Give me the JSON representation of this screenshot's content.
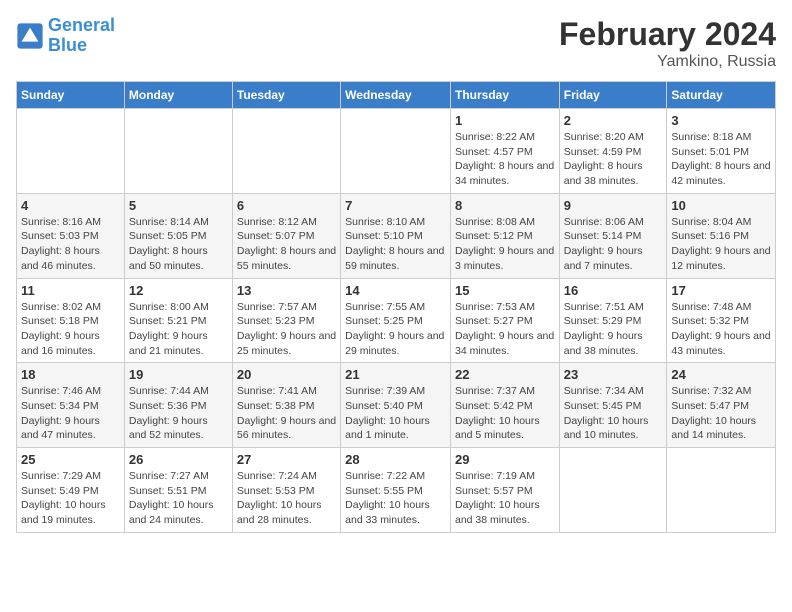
{
  "logo": {
    "line1": "General",
    "line2": "Blue"
  },
  "header": {
    "month": "February 2024",
    "location": "Yamkino, Russia"
  },
  "weekdays": [
    "Sunday",
    "Monday",
    "Tuesday",
    "Wednesday",
    "Thursday",
    "Friday",
    "Saturday"
  ],
  "weeks": [
    [
      {
        "day": "",
        "sunrise": "",
        "sunset": "",
        "daylight": ""
      },
      {
        "day": "",
        "sunrise": "",
        "sunset": "",
        "daylight": ""
      },
      {
        "day": "",
        "sunrise": "",
        "sunset": "",
        "daylight": ""
      },
      {
        "day": "",
        "sunrise": "",
        "sunset": "",
        "daylight": ""
      },
      {
        "day": "1",
        "sunrise": "Sunrise: 8:22 AM",
        "sunset": "Sunset: 4:57 PM",
        "daylight": "Daylight: 8 hours and 34 minutes."
      },
      {
        "day": "2",
        "sunrise": "Sunrise: 8:20 AM",
        "sunset": "Sunset: 4:59 PM",
        "daylight": "Daylight: 8 hours and 38 minutes."
      },
      {
        "day": "3",
        "sunrise": "Sunrise: 8:18 AM",
        "sunset": "Sunset: 5:01 PM",
        "daylight": "Daylight: 8 hours and 42 minutes."
      }
    ],
    [
      {
        "day": "4",
        "sunrise": "Sunrise: 8:16 AM",
        "sunset": "Sunset: 5:03 PM",
        "daylight": "Daylight: 8 hours and 46 minutes."
      },
      {
        "day": "5",
        "sunrise": "Sunrise: 8:14 AM",
        "sunset": "Sunset: 5:05 PM",
        "daylight": "Daylight: 8 hours and 50 minutes."
      },
      {
        "day": "6",
        "sunrise": "Sunrise: 8:12 AM",
        "sunset": "Sunset: 5:07 PM",
        "daylight": "Daylight: 8 hours and 55 minutes."
      },
      {
        "day": "7",
        "sunrise": "Sunrise: 8:10 AM",
        "sunset": "Sunset: 5:10 PM",
        "daylight": "Daylight: 8 hours and 59 minutes."
      },
      {
        "day": "8",
        "sunrise": "Sunrise: 8:08 AM",
        "sunset": "Sunset: 5:12 PM",
        "daylight": "Daylight: 9 hours and 3 minutes."
      },
      {
        "day": "9",
        "sunrise": "Sunrise: 8:06 AM",
        "sunset": "Sunset: 5:14 PM",
        "daylight": "Daylight: 9 hours and 7 minutes."
      },
      {
        "day": "10",
        "sunrise": "Sunrise: 8:04 AM",
        "sunset": "Sunset: 5:16 PM",
        "daylight": "Daylight: 9 hours and 12 minutes."
      }
    ],
    [
      {
        "day": "11",
        "sunrise": "Sunrise: 8:02 AM",
        "sunset": "Sunset: 5:18 PM",
        "daylight": "Daylight: 9 hours and 16 minutes."
      },
      {
        "day": "12",
        "sunrise": "Sunrise: 8:00 AM",
        "sunset": "Sunset: 5:21 PM",
        "daylight": "Daylight: 9 hours and 21 minutes."
      },
      {
        "day": "13",
        "sunrise": "Sunrise: 7:57 AM",
        "sunset": "Sunset: 5:23 PM",
        "daylight": "Daylight: 9 hours and 25 minutes."
      },
      {
        "day": "14",
        "sunrise": "Sunrise: 7:55 AM",
        "sunset": "Sunset: 5:25 PM",
        "daylight": "Daylight: 9 hours and 29 minutes."
      },
      {
        "day": "15",
        "sunrise": "Sunrise: 7:53 AM",
        "sunset": "Sunset: 5:27 PM",
        "daylight": "Daylight: 9 hours and 34 minutes."
      },
      {
        "day": "16",
        "sunrise": "Sunrise: 7:51 AM",
        "sunset": "Sunset: 5:29 PM",
        "daylight": "Daylight: 9 hours and 38 minutes."
      },
      {
        "day": "17",
        "sunrise": "Sunrise: 7:48 AM",
        "sunset": "Sunset: 5:32 PM",
        "daylight": "Daylight: 9 hours and 43 minutes."
      }
    ],
    [
      {
        "day": "18",
        "sunrise": "Sunrise: 7:46 AM",
        "sunset": "Sunset: 5:34 PM",
        "daylight": "Daylight: 9 hours and 47 minutes."
      },
      {
        "day": "19",
        "sunrise": "Sunrise: 7:44 AM",
        "sunset": "Sunset: 5:36 PM",
        "daylight": "Daylight: 9 hours and 52 minutes."
      },
      {
        "day": "20",
        "sunrise": "Sunrise: 7:41 AM",
        "sunset": "Sunset: 5:38 PM",
        "daylight": "Daylight: 9 hours and 56 minutes."
      },
      {
        "day": "21",
        "sunrise": "Sunrise: 7:39 AM",
        "sunset": "Sunset: 5:40 PM",
        "daylight": "Daylight: 10 hours and 1 minute."
      },
      {
        "day": "22",
        "sunrise": "Sunrise: 7:37 AM",
        "sunset": "Sunset: 5:42 PM",
        "daylight": "Daylight: 10 hours and 5 minutes."
      },
      {
        "day": "23",
        "sunrise": "Sunrise: 7:34 AM",
        "sunset": "Sunset: 5:45 PM",
        "daylight": "Daylight: 10 hours and 10 minutes."
      },
      {
        "day": "24",
        "sunrise": "Sunrise: 7:32 AM",
        "sunset": "Sunset: 5:47 PM",
        "daylight": "Daylight: 10 hours and 14 minutes."
      }
    ],
    [
      {
        "day": "25",
        "sunrise": "Sunrise: 7:29 AM",
        "sunset": "Sunset: 5:49 PM",
        "daylight": "Daylight: 10 hours and 19 minutes."
      },
      {
        "day": "26",
        "sunrise": "Sunrise: 7:27 AM",
        "sunset": "Sunset: 5:51 PM",
        "daylight": "Daylight: 10 hours and 24 minutes."
      },
      {
        "day": "27",
        "sunrise": "Sunrise: 7:24 AM",
        "sunset": "Sunset: 5:53 PM",
        "daylight": "Daylight: 10 hours and 28 minutes."
      },
      {
        "day": "28",
        "sunrise": "Sunrise: 7:22 AM",
        "sunset": "Sunset: 5:55 PM",
        "daylight": "Daylight: 10 hours and 33 minutes."
      },
      {
        "day": "29",
        "sunrise": "Sunrise: 7:19 AM",
        "sunset": "Sunset: 5:57 PM",
        "daylight": "Daylight: 10 hours and 38 minutes."
      },
      {
        "day": "",
        "sunrise": "",
        "sunset": "",
        "daylight": ""
      },
      {
        "day": "",
        "sunrise": "",
        "sunset": "",
        "daylight": ""
      }
    ]
  ]
}
